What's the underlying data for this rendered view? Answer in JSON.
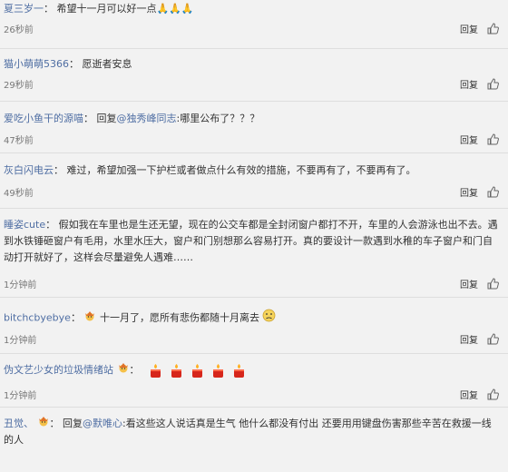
{
  "comments": [
    {
      "user": "夏三岁一",
      "sep": "：",
      "text": "希望十一月可以好一点🙏🙏🙏",
      "time": "26秒前",
      "reply": "回复"
    },
    {
      "user": "猫小萌萌5366",
      "sep": "：",
      "text": "愿逝者安息",
      "time": "29秒前",
      "reply": "回复"
    },
    {
      "user": "爱吃小鱼干的源喵",
      "sep": "：",
      "text_prefix": "回复",
      "at": "@独秀峰同志",
      "text": ":哪里公布了？？？",
      "time": "47秒前",
      "reply": "回复"
    },
    {
      "user": "灰白闪电云",
      "sep": "：",
      "text": "难过，希望加强一下护栏或者做点什么有效的措施，不要再有了，不要再有了。",
      "time": "49秒前",
      "reply": "回复"
    },
    {
      "user": "睡姿cute",
      "sep": "：",
      "text": "假如我在车里也是生还无望，现在的公交车都是全封闭窗户都打不开，车里的人会游泳也出不去。遇到水铁锤砸窗户有毛用，水里水压大，窗户和门别想那么容易打开。真的要设计一款遇到水稚的车子窗户和门自动打开就好了，这样会尽量避免人遇难……",
      "time": "1分钟前",
      "reply": "回复"
    },
    {
      "user": "bitchcbyebye",
      "sep": "：",
      "text": "十一月了，愿所有悲伤都随十月离去",
      "time": "1分钟前",
      "reply": "回复"
    },
    {
      "user": "伪文艺少女的垃圾情绪站",
      "sep": "：",
      "text": "",
      "time": "1分钟前",
      "reply": "回复"
    },
    {
      "user": "丑觉、",
      "sep": "：",
      "text_prefix": "回复",
      "at": "@默唯心",
      "text": ":看这些这人说话真是生气 他什么都没有付出 还要用用键盘伤害那些辛苦在救援一线的人",
      "time": "",
      "reply": ""
    }
  ]
}
